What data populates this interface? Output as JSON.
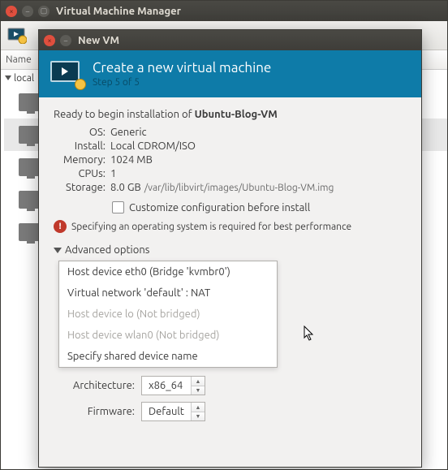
{
  "main": {
    "title": "Virtual Machine Manager",
    "list_header": "Name",
    "tree_root": "local"
  },
  "dialog": {
    "titlebar": "New VM",
    "header_title": "Create a new virtual machine",
    "step": "Step 5 of 5",
    "ready_prefix": "Ready to begin installation of ",
    "vm_name": "Ubuntu-Blog-VM",
    "os_label": "OS:",
    "os_value": "Generic",
    "install_label": "Install:",
    "install_value": "Local CDROM/ISO",
    "memory_label": "Memory:",
    "memory_value": "1024 MB",
    "cpus_label": "CPUs:",
    "cpus_value": "1",
    "storage_label": "Storage:",
    "storage_value": "8.0 GB",
    "storage_path": "/var/lib/libvirt/images/Ubuntu-Blog-VM.img",
    "customize_label": "Customize configuration before install",
    "warning": "Specifying an operating system is required for best performance",
    "advanced": "Advanced options",
    "network_options": [
      "Host device eth0 (Bridge 'kvmbr0')",
      "Virtual network 'default' : NAT",
      "Host device lo (Not bridged)",
      "Host device wlan0 (Not bridged)",
      "Specify shared device name"
    ],
    "arch_label": "Architecture:",
    "arch_value": "x86_64",
    "firmware_label": "Firmware:",
    "firmware_value": "Default"
  }
}
